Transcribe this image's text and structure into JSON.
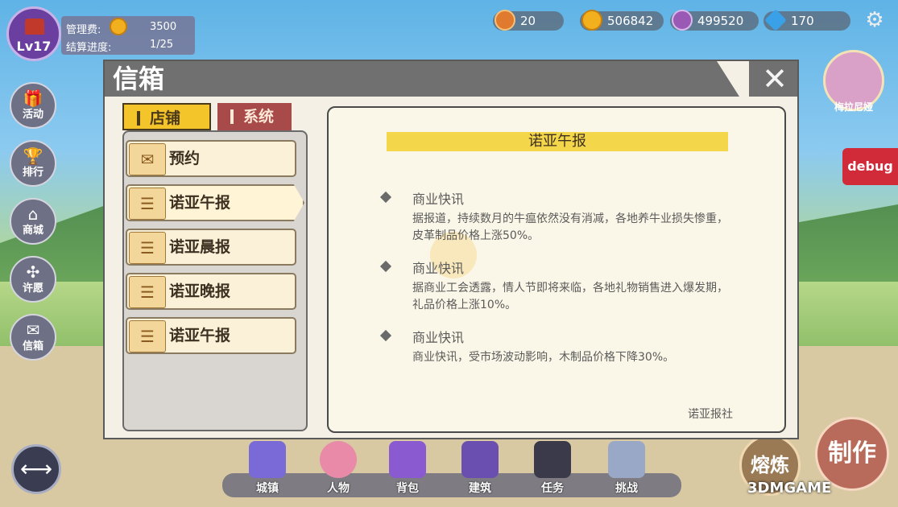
{
  "hud": {
    "level": "Lv17",
    "management_fee_label": "管理费:",
    "management_fee_value": "3500",
    "settlement_label": "结算进度:",
    "settlement_value": "1/25",
    "resources": [
      {
        "name": "badge-resource",
        "value": "20",
        "color": "#e07a2e"
      },
      {
        "name": "gold-coin",
        "value": "506842",
        "color": "#f2b01e"
      },
      {
        "name": "purple-medal",
        "value": "499520",
        "color": "#9b59b6"
      },
      {
        "name": "diamond",
        "value": "170",
        "color": "#3aa0e8"
      }
    ]
  },
  "side_menu": [
    {
      "label": "活动",
      "icon": "gift-icon"
    },
    {
      "label": "排行",
      "icon": "trophy-icon"
    },
    {
      "label": "商城",
      "icon": "shop-icon"
    },
    {
      "label": "许愿",
      "icon": "pinwheel-icon"
    },
    {
      "label": "信箱",
      "icon": "envelope-icon"
    }
  ],
  "right": {
    "hero_label": "梅拉尼娅",
    "debug_label": "debug",
    "make_label": "制作",
    "melt_label": "熔炼"
  },
  "bottom_nav": [
    {
      "label": "城镇",
      "color": "#7a6ad8"
    },
    {
      "label": "人物",
      "color": "#e88aa8"
    },
    {
      "label": "背包",
      "color": "#8a5ad0"
    },
    {
      "label": "建筑",
      "color": "#6a4fb0"
    },
    {
      "label": "任务",
      "color": "#3a3a4a"
    },
    {
      "label": "挑战",
      "color": "#9aa8c8"
    }
  ],
  "dialog": {
    "title": "信箱",
    "tabs": [
      {
        "label": "店铺",
        "active": true
      },
      {
        "label": "系统",
        "active": false
      }
    ],
    "mails": [
      {
        "label": "预约",
        "icon": "envelope-icon"
      },
      {
        "label": "诺亚午报",
        "icon": "scroll-icon"
      },
      {
        "label": "诺亚晨报",
        "icon": "scroll-icon"
      },
      {
        "label": "诺亚晚报",
        "icon": "scroll-icon"
      },
      {
        "label": "诺亚午报",
        "icon": "scroll-icon"
      }
    ],
    "content": {
      "title": "诺亚午报",
      "news": [
        {
          "head": "商业快讯",
          "body": "据报道，持续数月的牛瘟依然没有消减，各地养牛业损失惨重，皮革制品价格上涨50%。"
        },
        {
          "head": "商业快讯",
          "body": "据商业工会透露，情人节即将来临，各地礼物销售进入爆发期，礼品价格上涨10%。"
        },
        {
          "head": "商业快讯",
          "body": "商业快讯，受市场波动影响，木制品价格下降30%。"
        }
      ],
      "signature": "诺亚报社"
    }
  },
  "watermark": "3DMGAME"
}
